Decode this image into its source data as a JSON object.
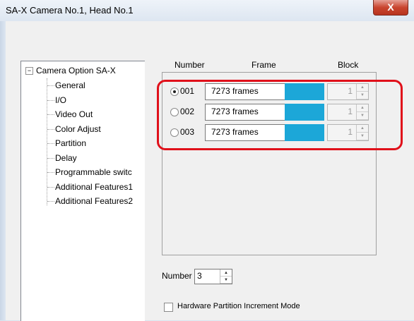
{
  "window": {
    "title": "SA-X  Camera No.1, Head No.1",
    "close_label": "X"
  },
  "tree": {
    "root_expander": "−",
    "root_label": "Camera Option SA-X",
    "items": [
      "General",
      "I/O",
      "Video Out",
      "Color Adjust",
      "Partition",
      "Delay",
      "Programmable switc",
      "Additional Features1",
      "Additional Features2"
    ]
  },
  "table": {
    "headers": {
      "number": "Number",
      "frame": "Frame",
      "block": "Block"
    },
    "rows": [
      {
        "number": "001",
        "frames": "7273 frames",
        "block": "1",
        "selected": true
      },
      {
        "number": "002",
        "frames": "7273 frames",
        "block": "1",
        "selected": false
      },
      {
        "number": "003",
        "frames": "7273 frames",
        "block": "1",
        "selected": false
      }
    ],
    "swatch_color": "#1ca7d8",
    "highlight_color": "#e0101a"
  },
  "number_control": {
    "label": "Number",
    "value": "3"
  },
  "hardware_partition": {
    "label": "Hardware Partition Increment Mode",
    "checked": false
  }
}
